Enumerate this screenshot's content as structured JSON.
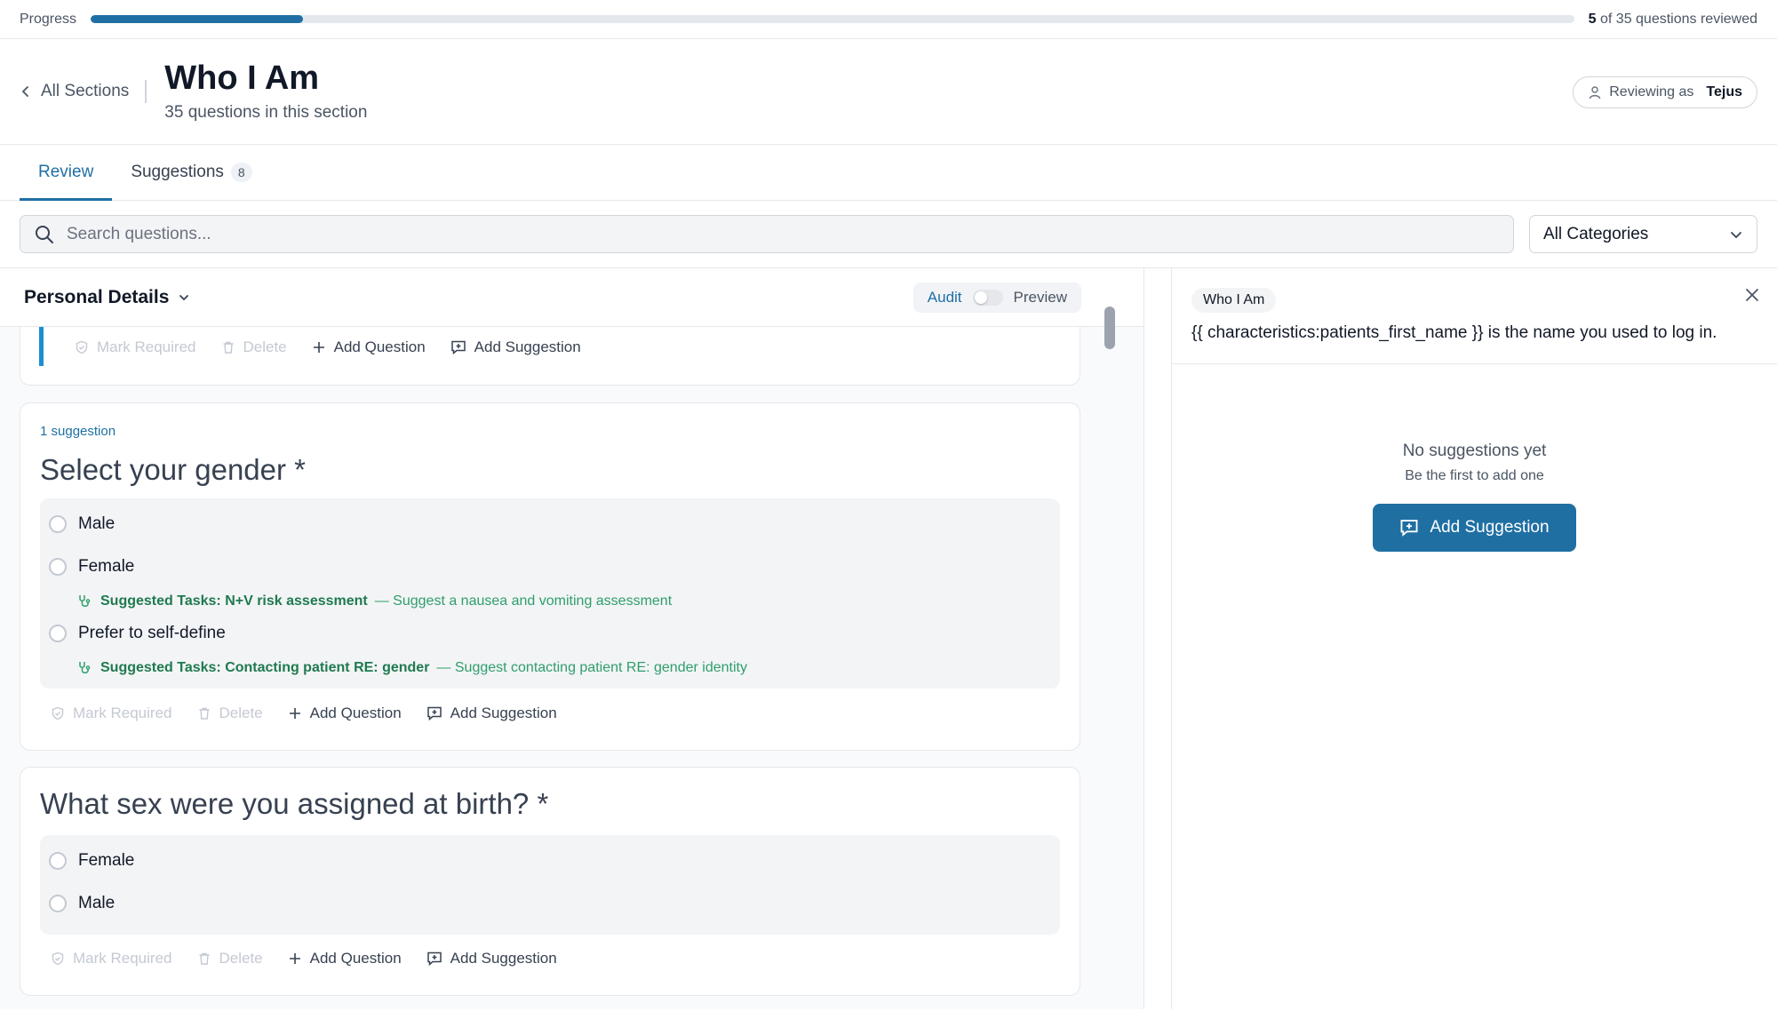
{
  "progress": {
    "label": "Progress",
    "reviewed": 5,
    "total": 35,
    "bold": "5",
    "rest": "of 35 questions reviewed"
  },
  "header": {
    "back_label": "All Sections",
    "title": "Who I Am",
    "subtitle": "35 questions in this section",
    "reviewing_label": "Reviewing as",
    "reviewer": "Tejus"
  },
  "tabs": [
    {
      "label": "Review",
      "active": true
    },
    {
      "label": "Suggestions",
      "count": "8"
    }
  ],
  "search": {
    "placeholder": "Search questions..."
  },
  "category_select": {
    "value": "All Categories"
  },
  "section": {
    "title": "Personal Details",
    "toggle_left": "Audit",
    "toggle_right": "Preview"
  },
  "actions": {
    "mark_required": "Mark Required",
    "delete": "Delete",
    "add_question": "Add Question",
    "add_suggestion": "Add Suggestion"
  },
  "questions": [
    {
      "suggestion_count": "1 suggestion",
      "title": "Select your gender *",
      "options": [
        "Male",
        "Female",
        "Prefer to self-define"
      ],
      "tasks": [
        {
          "label": "Suggested Tasks: N+V risk assessment",
          "detail": "— Suggest a nausea and vomiting assessment"
        },
        {
          "label": "Suggested Tasks: Contacting patient RE: gender",
          "detail": "— Suggest contacting patient RE: gender identity"
        }
      ]
    },
    {
      "title": "What sex were you assigned at birth? *",
      "options": [
        "Female",
        "Male"
      ]
    }
  ],
  "panel": {
    "section_pill": "Who I Am",
    "question_text": "{{ characteristics:patients_first_name }} is the name you used to log in.",
    "empty_title": "No suggestions yet",
    "empty_sub": "Be the first to add one",
    "button_label": "Add Suggestion"
  },
  "colors": {
    "accent": "#1f6fa3",
    "task_green": "#2e9e6b"
  }
}
